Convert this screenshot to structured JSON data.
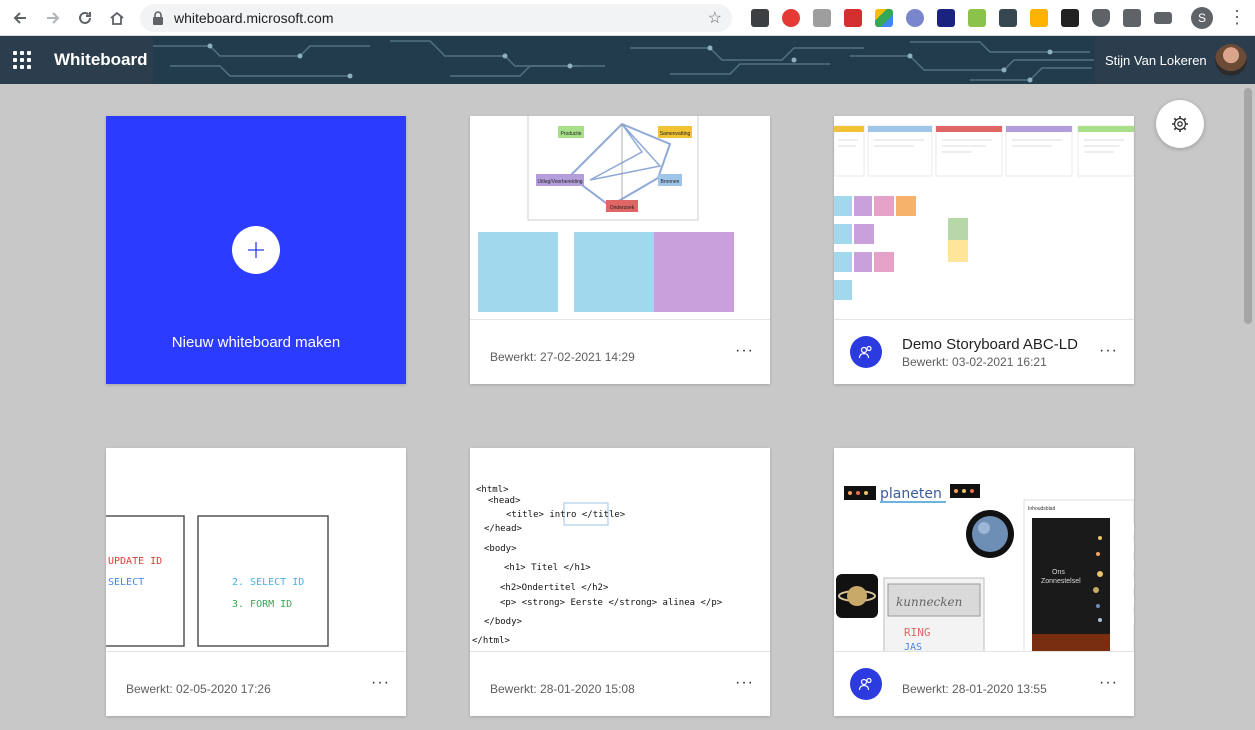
{
  "browser": {
    "url": "whiteboard.microsoft.com",
    "profile_initial": "S"
  },
  "header": {
    "app_title": "Whiteboard",
    "user_name": "Stijn Van Lokeren"
  },
  "new_board": {
    "label": "Nieuw whiteboard maken"
  },
  "boards": [
    {
      "title": "",
      "edited": "Bewerkt: 27-02-2021 14:29",
      "shared": false
    },
    {
      "title": "Demo Storyboard ABC-LD",
      "edited": "Bewerkt: 03-02-2021 16:21",
      "shared": true
    },
    {
      "title": "",
      "edited": "Bewerkt: 02-05-2020 17:26",
      "shared": false
    },
    {
      "title": "",
      "edited": "Bewerkt: 28-01-2020 15:08",
      "shared": false
    },
    {
      "title": "",
      "edited": "Bewerkt: 28-01-2020 13:55",
      "shared": true
    }
  ],
  "thumb_text": {
    "radar": {
      "productie": "Productie",
      "samenvatting": "Samenvatting",
      "uitleg": "Uitleg/Voorbereiding",
      "bronnen": "Bronnen",
      "onderzoek": "Onderzoek"
    },
    "sql": {
      "update": "UPDATE ID",
      "select": "SELECT",
      "select2": "2. SELECT ID",
      "form": "3. FORM ID"
    },
    "html_lines": [
      "<html>",
      "<head>",
      "<title>  intro  </title>",
      "</head>",
      "<body>",
      "<h1>  Titel  </h1>",
      "<h2>Ondertitel  </h2>",
      "<p> <strong>  Eerste </strong>  alinea  </p>",
      "</body>",
      "</html>"
    ],
    "planets": {
      "title": "planeten",
      "word1": "kunnecken",
      "word2": "RING",
      "word3": "JAS",
      "panel_title": "Inhoudsblad",
      "ons": "Ons",
      "zon": "Zonnestelsel"
    }
  },
  "colors": {
    "accent": "#2b3bff",
    "shared_badge": "#2b3be0",
    "header_bg": "#1f3746"
  }
}
